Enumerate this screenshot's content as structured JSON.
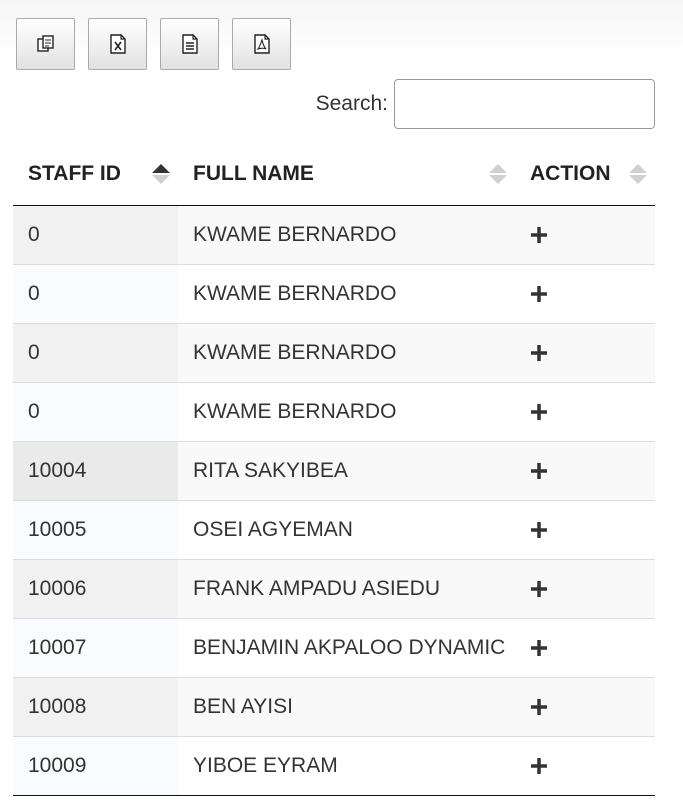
{
  "toolbar": {
    "buttons": [
      {
        "name": "copy-button",
        "icon": "copy-icon"
      },
      {
        "name": "excel-button",
        "icon": "excel-file-icon"
      },
      {
        "name": "csv-button",
        "icon": "text-file-icon"
      },
      {
        "name": "pdf-button",
        "icon": "pdf-file-icon"
      }
    ]
  },
  "search": {
    "label": "Search:",
    "value": "",
    "placeholder": ""
  },
  "table": {
    "headers": {
      "staff_id": "STAFF ID",
      "full_name": "FULL NAME",
      "action": "ACTION"
    },
    "sorted_column": "staff_id",
    "sort_direction": "ascending",
    "rows": [
      {
        "staff_id": "0",
        "full_name": "KWAME BERNARDO",
        "action_icon": "plus-icon"
      },
      {
        "staff_id": "0",
        "full_name": "KWAME BERNARDO",
        "action_icon": "plus-icon"
      },
      {
        "staff_id": "0",
        "full_name": "KWAME BERNARDO",
        "action_icon": "plus-icon"
      },
      {
        "staff_id": "0",
        "full_name": "KWAME BERNARDO",
        "action_icon": "plus-icon"
      },
      {
        "staff_id": "10004",
        "full_name": "RITA SAKYIBEA",
        "action_icon": "plus-icon"
      },
      {
        "staff_id": "10005",
        "full_name": "OSEI AGYEMAN",
        "action_icon": "plus-icon"
      },
      {
        "staff_id": "10006",
        "full_name": "FRANK AMPADU ASIEDU",
        "action_icon": "plus-icon"
      },
      {
        "staff_id": "10007",
        "full_name": "BENJAMIN AKPALOO DYNAMIC",
        "action_icon": "plus-icon"
      },
      {
        "staff_id": "10008",
        "full_name": "BEN AYISI",
        "action_icon": "plus-icon"
      },
      {
        "staff_id": "10009",
        "full_name": "YIBOE EYRAM",
        "action_icon": "plus-icon"
      }
    ]
  }
}
